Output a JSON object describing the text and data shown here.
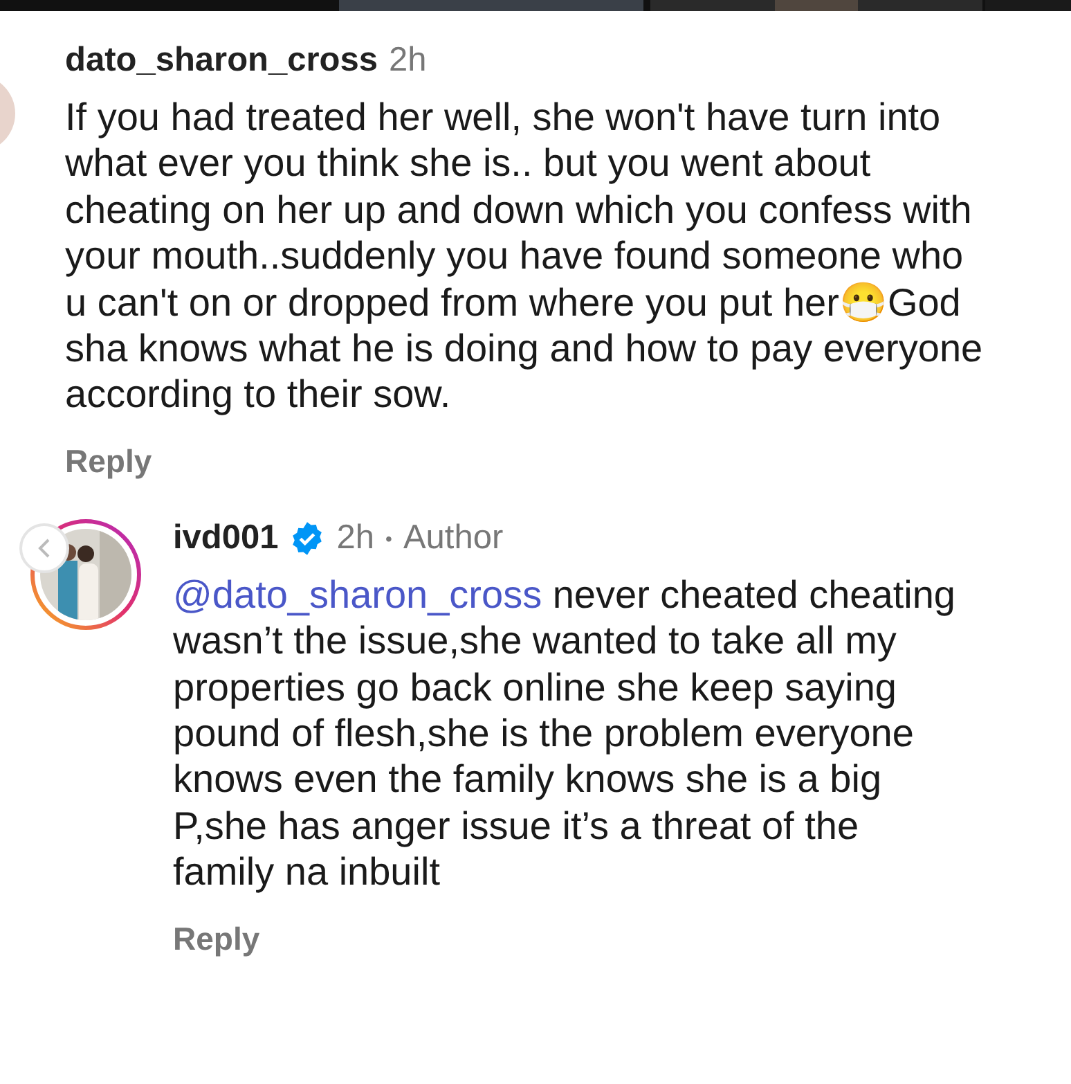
{
  "comments": [
    {
      "username": "dato_sharon_cross",
      "verified": false,
      "time": "2h",
      "text": "If you had treated her well, she won't have turn into what ever you think she is.. but you went about cheating on her up and down which you confess with your mouth..suddenly you have found someone who u can't on or dropped from where you put her😷God sha knows what he is doing and how to pay everyone according to their sow.",
      "reply": "Reply",
      "avatar_cut": true
    },
    {
      "username": "ivd001",
      "verified": true,
      "time": "2h",
      "separator": "•",
      "author_label": "Author",
      "mention": "@dato_sharon_cross",
      "text": "never cheated cheating wasn’t the issue,she wanted to take all my properties go back online she keep saying pound of flesh,she is the problem everyone knows even the family knows she is a big P,she has anger issue it’s a threat of the family na inbuilt",
      "reply": "Reply",
      "avatar_cut": false
    }
  ]
}
